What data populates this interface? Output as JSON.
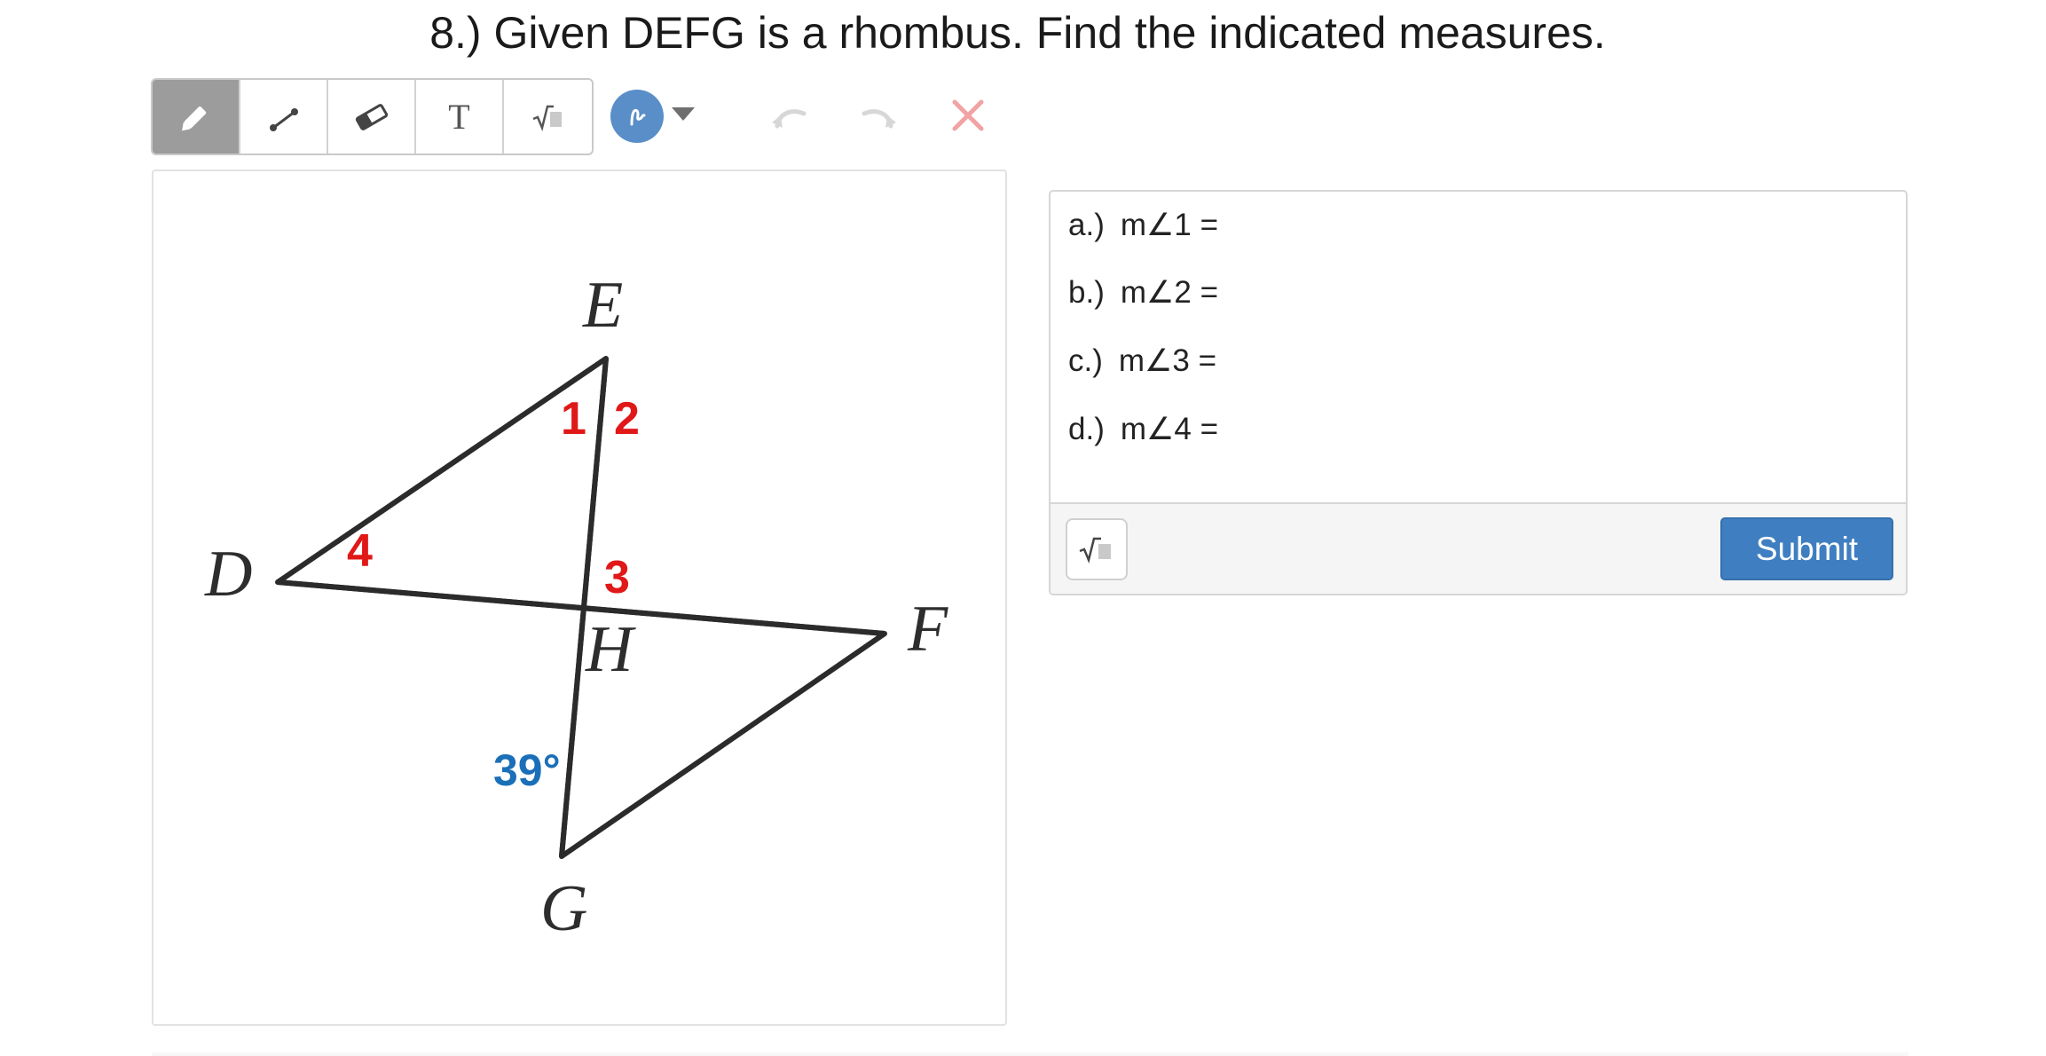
{
  "question": {
    "title": "8.) Given DEFG is a rhombus. Find the indicated measures."
  },
  "toolbar": {
    "tools": [
      {
        "icon": "pencil-icon",
        "active": true
      },
      {
        "icon": "line-segment-icon",
        "active": false
      },
      {
        "icon": "eraser-icon",
        "active": false
      },
      {
        "icon": "text-tool-icon",
        "glyph": "T",
        "active": false
      },
      {
        "icon": "square-root-icon",
        "active": false
      }
    ],
    "color_picker": {
      "color": "#5a8ec8",
      "icon": "squiggle-icon"
    },
    "actions": [
      "undo-icon",
      "redo-icon",
      "clear-icon"
    ]
  },
  "figure": {
    "vertices": {
      "d": "D",
      "e": "E",
      "f": "F",
      "g": "G",
      "h": "H"
    },
    "angle_labels": {
      "a1": "1",
      "a2": "2",
      "a3": "3",
      "a4": "4"
    },
    "given_angle": "39°",
    "colors": {
      "edge": "#2b2b2b",
      "angle_label": "#e01818",
      "given_label": "#1b6fb8"
    }
  },
  "answers": {
    "items": [
      {
        "label": "a.)",
        "expr": "m∠1 ="
      },
      {
        "label": "b.)",
        "expr": "m∠2 ="
      },
      {
        "label": "c.)",
        "expr": "m∠3 ="
      },
      {
        "label": "d.)",
        "expr": "m∠4 ="
      }
    ],
    "submit_label": "Submit",
    "submit_color": "#3f7fc1"
  }
}
